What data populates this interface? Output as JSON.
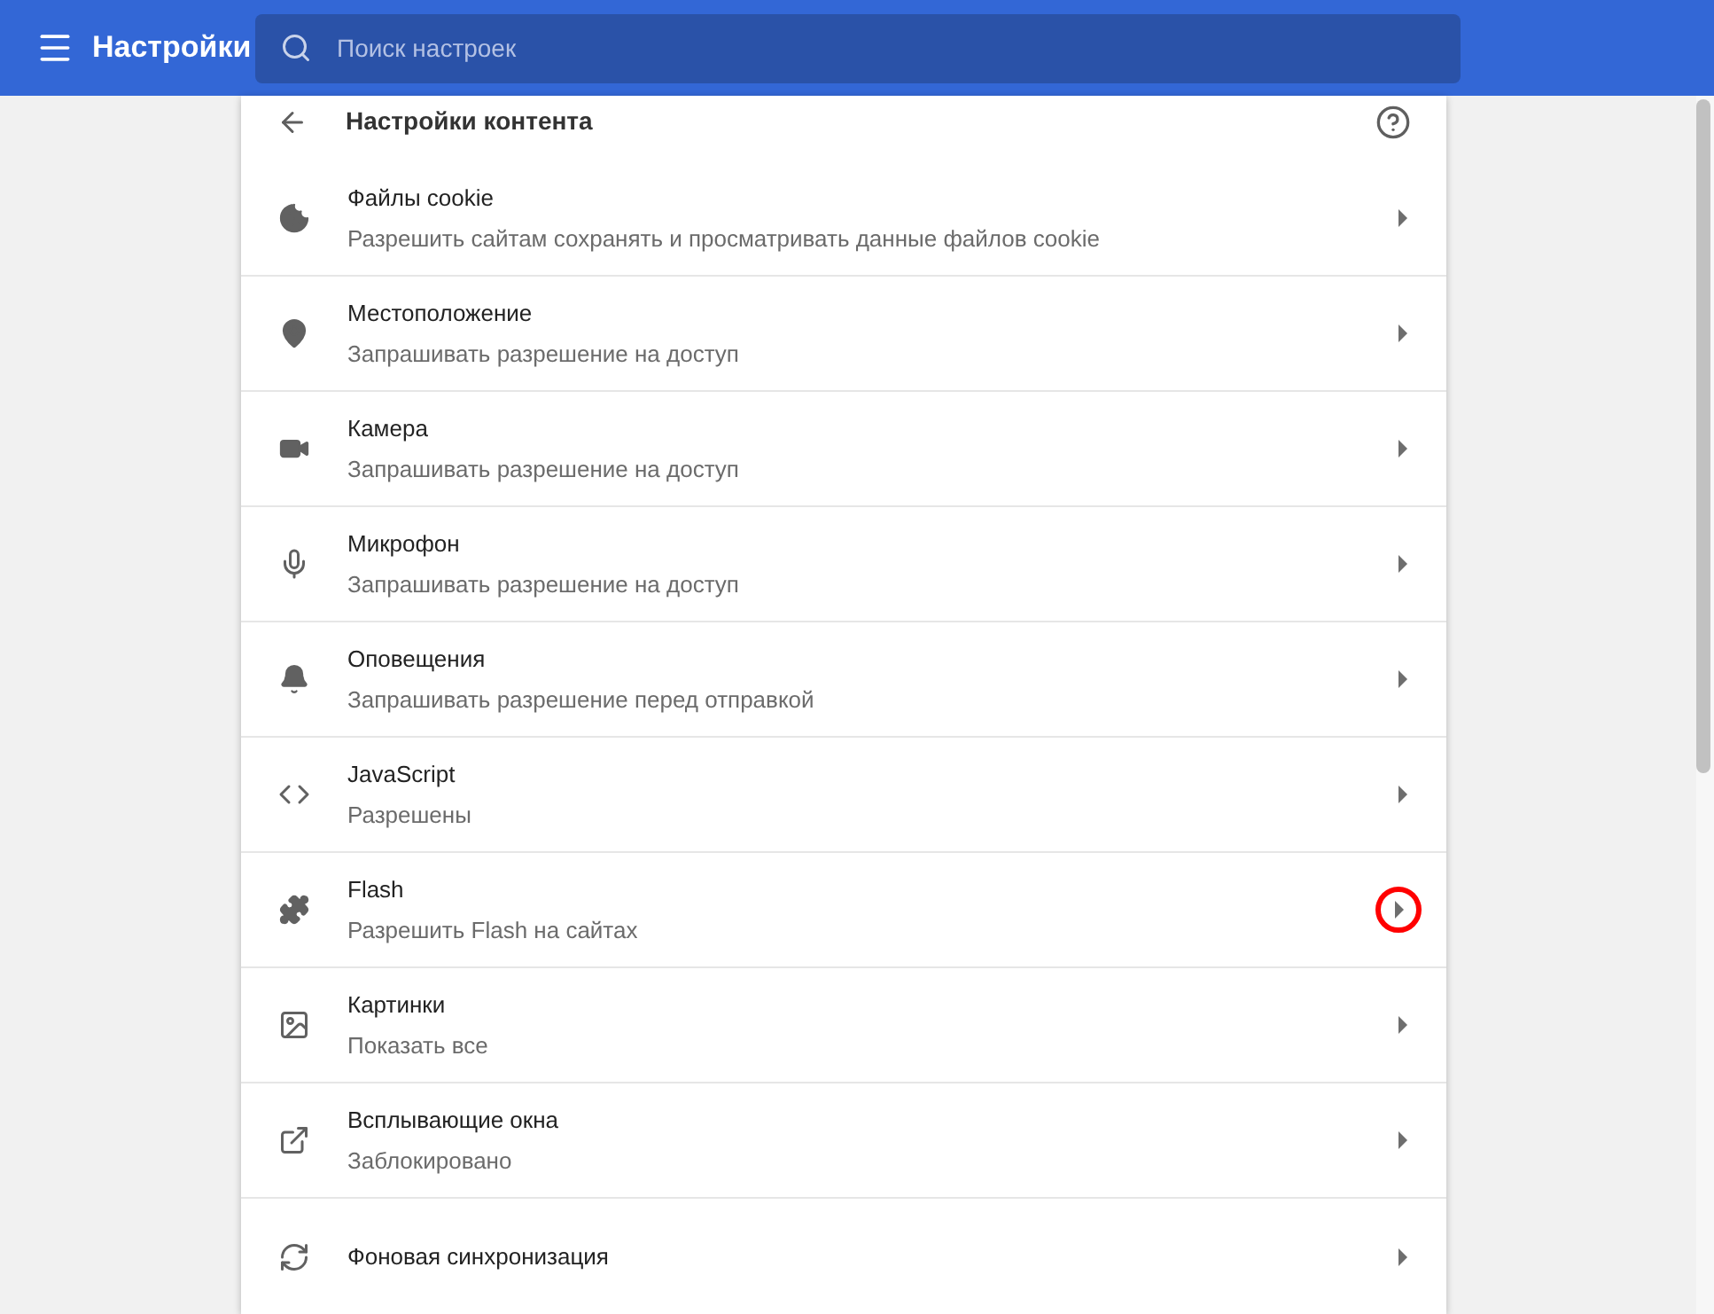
{
  "header": {
    "title": "Настройки",
    "search": {
      "placeholder": "Поиск настроек"
    }
  },
  "page": {
    "title": "Настройки контента"
  },
  "items": [
    {
      "title": "Файлы cookie",
      "subtitle": "Разрешить сайтам сохранять и просматривать данные файлов cookie",
      "highlighted": false
    },
    {
      "title": "Местоположение",
      "subtitle": "Запрашивать разрешение на доступ",
      "highlighted": false
    },
    {
      "title": "Камера",
      "subtitle": "Запрашивать разрешение на доступ",
      "highlighted": false
    },
    {
      "title": "Микрофон",
      "subtitle": "Запрашивать разрешение на доступ",
      "highlighted": false
    },
    {
      "title": "Оповещения",
      "subtitle": "Запрашивать разрешение перед отправкой",
      "highlighted": false
    },
    {
      "title": "JavaScript",
      "subtitle": "Разрешены",
      "highlighted": false
    },
    {
      "title": "Flash",
      "subtitle": "Разрешить Flash на сайтах",
      "highlighted": true
    },
    {
      "title": "Картинки",
      "subtitle": "Показать все",
      "highlighted": false
    },
    {
      "title": "Всплывающие окна",
      "subtitle": "Заблокировано",
      "highlighted": false
    },
    {
      "title": "Фоновая синхронизация",
      "highlighted": false
    }
  ]
}
